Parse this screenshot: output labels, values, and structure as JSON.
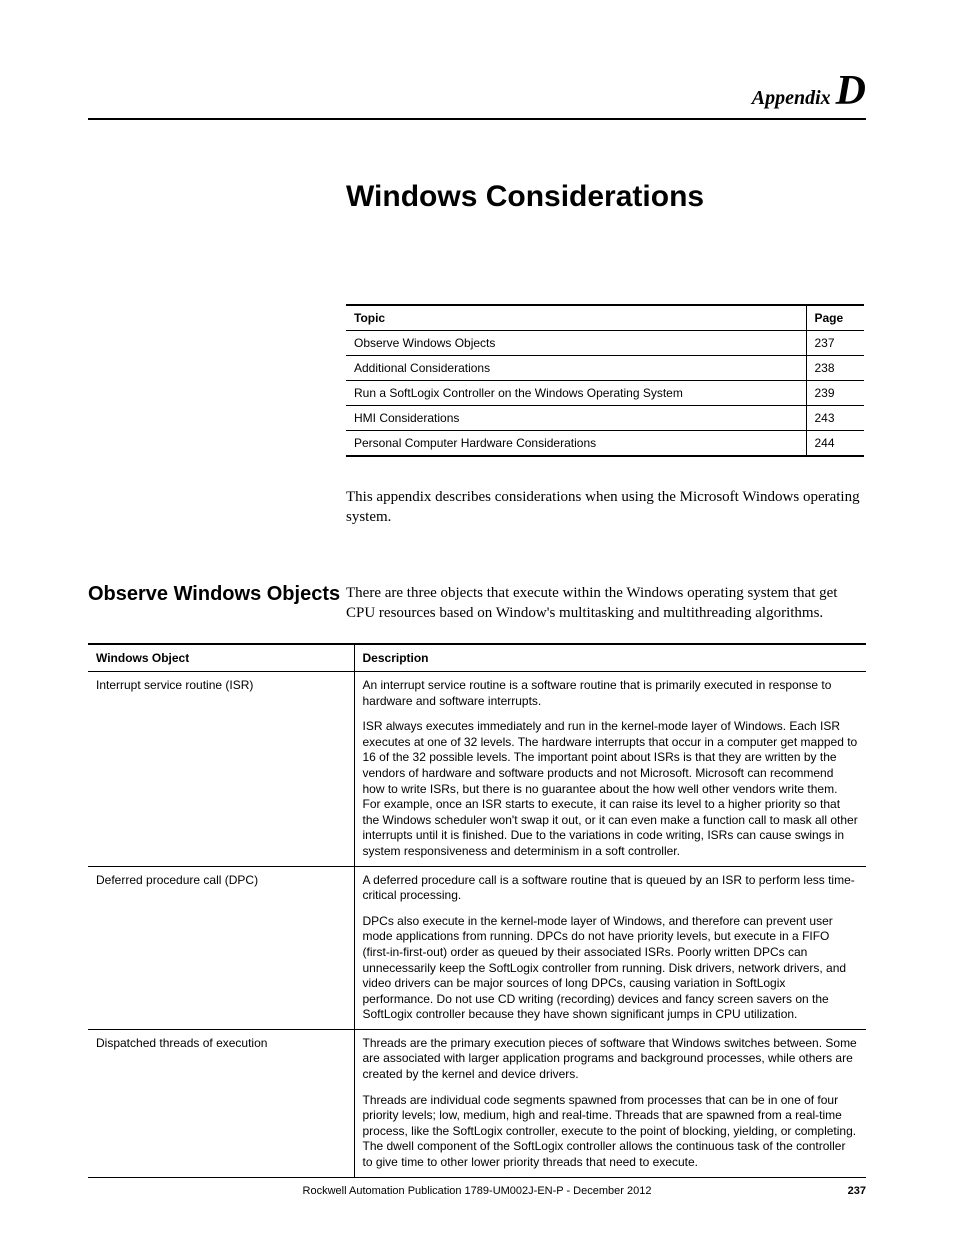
{
  "header": {
    "appendix_word": "Appendix",
    "appendix_letter": "D"
  },
  "chapter_title": "Windows Considerations",
  "toc": {
    "col_topic": "Topic",
    "col_page": "Page",
    "rows": [
      {
        "topic": "Observe Windows Objects",
        "page": "237"
      },
      {
        "topic": "Additional Considerations",
        "page": "238"
      },
      {
        "topic": "Run a SoftLogix Controller on the Windows Operating System",
        "page": "239"
      },
      {
        "topic": "HMI Considerations",
        "page": "243"
      },
      {
        "topic": "Personal Computer Hardware Considerations",
        "page": "244"
      }
    ]
  },
  "intro_paragraph": "This appendix describes considerations when using the Microsoft Windows operating system.",
  "section": {
    "heading": "Observe Windows Objects",
    "paragraph": "There are three objects that execute within the Windows operating system that get CPU resources based on Window's multitasking and multithreading algorithms."
  },
  "objects_table": {
    "col_object": "Windows Object",
    "col_description": "Description",
    "rows": [
      {
        "name": "Interrupt service routine (ISR)",
        "desc_p1": "An interrupt service routine is a software routine that is primarily executed in response to hardware and software interrupts.",
        "desc_p2": "ISR always executes immediately and run in the kernel-mode layer of Windows.   Each ISR executes at one of 32 levels. The hardware interrupts that occur in a computer get mapped to 16 of the 32 possible levels. The important point about ISRs is that they are written by the vendors of hardware and software products and not Microsoft. Microsoft can recommend how to write ISRs, but there is no guarantee about the how well other vendors write them. For example, once an ISR starts to execute, it can raise its level to a higher priority so that the Windows scheduler won't swap it out, or it can even make a function call to mask all other interrupts until it is finished. Due to the variations in code writing, ISRs can cause swings in system responsiveness and determinism in a soft controller."
      },
      {
        "name": "Deferred procedure call (DPC)",
        "desc_p1": "A deferred procedure call is a software routine that is queued by an ISR to perform less time-critical processing.",
        "desc_p2": "DPCs also execute in the kernel-mode layer of Windows, and therefore can prevent user mode applications from running. DPCs do not have priority levels, but execute in a FIFO (first-in-first-out) order as queued by their associated ISRs. Poorly written DPCs can unnecessarily keep the SoftLogix controller from running. Disk drivers, network drivers, and video drivers can be major sources of long DPCs, causing variation in SoftLogix performance. Do not use CD writing (recording) devices and fancy screen savers on the SoftLogix controller because they have shown significant jumps in CPU utilization."
      },
      {
        "name": "Dispatched threads of execution",
        "desc_p1": "Threads are the primary execution pieces of software that Windows switches between. Some are associated with larger application programs and background processes, while others are created by the kernel and device drivers.",
        "desc_p2": "Threads are individual code segments spawned from processes that can be in one of four priority levels; low, medium, high and real-time. Threads that are spawned from a real-time process, like the SoftLogix controller, execute to the point of blocking, yielding, or completing.   The dwell component of the SoftLogix controller allows the continuous task of the controller to give time to other lower priority threads that need to execute."
      }
    ]
  },
  "footer": {
    "publication": "Rockwell Automation Publication 1789-UM002J-EN-P - December 2012",
    "page_number": "237"
  }
}
